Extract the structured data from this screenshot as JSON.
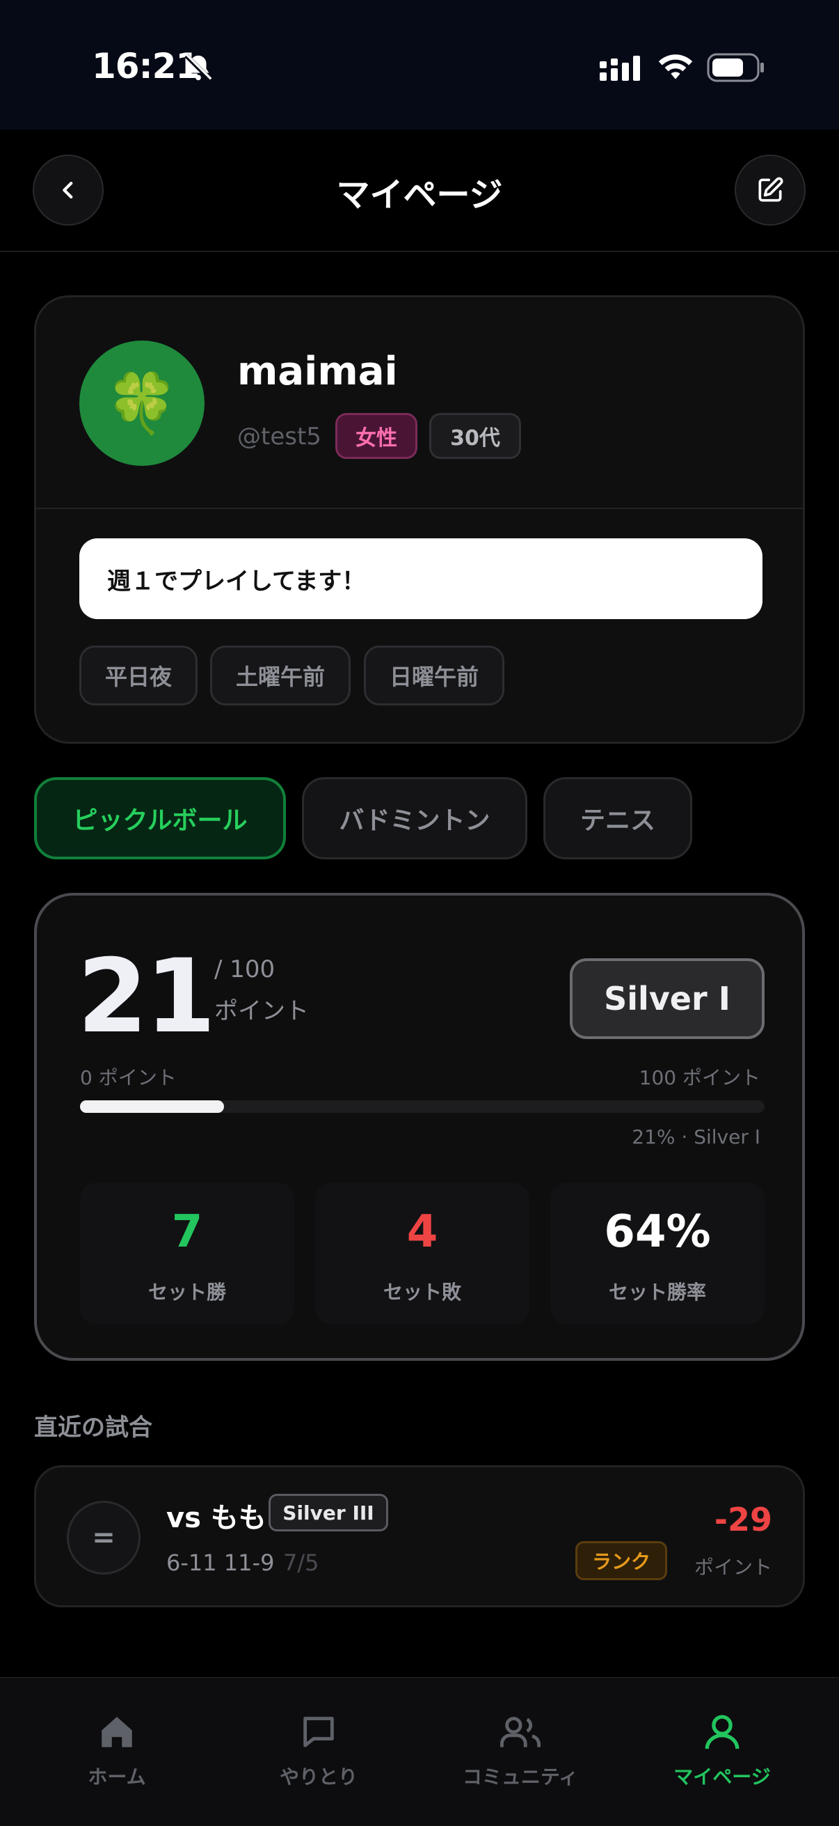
{
  "status_bar": {
    "time": "16:21"
  },
  "header": {
    "title": "マイページ"
  },
  "profile": {
    "avatar_emoji": "🍀",
    "name": "maimai",
    "handle": "@test5",
    "gender_tag": "女性",
    "age_tag": "30代",
    "bio": "週１でプレイしてます！",
    "availability": [
      "平日夜",
      "土曜午前",
      "日曜午前"
    ]
  },
  "sport_tabs": [
    {
      "label": "ピックルボール",
      "active": true
    },
    {
      "label": "バドミントン",
      "active": false
    },
    {
      "label": "テニス",
      "active": false
    }
  ],
  "stats": {
    "points": "21",
    "points_max": "/ 100",
    "points_unit": "ポイント",
    "rank": "Silver I",
    "progress_min_label": "0 ポイント",
    "progress_max_label": "100 ポイント",
    "progress_fraction": 0.21,
    "progress_caption": "21% · Silver I",
    "set_wins": "7",
    "set_wins_label": "セット勝",
    "set_losses": "4",
    "set_losses_label": "セット敗",
    "win_rate": "64%",
    "win_rate_label": "セット勝率"
  },
  "recent": {
    "title": "直近の試合",
    "match": {
      "result_symbol": "=",
      "opponent": "vs もも",
      "opponent_rank": "Silver III",
      "score": "6-11 11-9",
      "date": "7/5",
      "type_tag": "ランク",
      "delta": "-29",
      "delta_unit": "ポイント"
    }
  },
  "nav": {
    "home": "ホーム",
    "chat": "やりとり",
    "community": "コミュニティ",
    "mypage": "マイページ"
  },
  "colors": {
    "accent_green": "#22c55e",
    "loss_red": "#ef4444",
    "rank_orange": "#e59a1c",
    "gender_pink": "#ff6fb0"
  }
}
